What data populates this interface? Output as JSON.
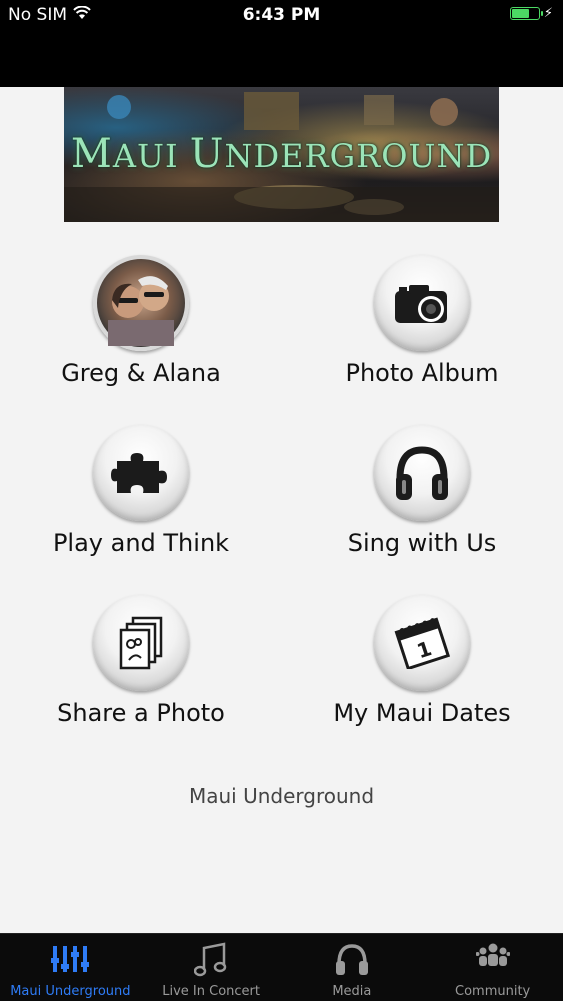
{
  "status_bar": {
    "carrier": "No SIM",
    "time": "6:43 PM",
    "battery_level": 0.7
  },
  "banner": {
    "title_part1": "M",
    "title_part2": "AUI ",
    "title_part3": "U",
    "title_part4": "NDERGROUND"
  },
  "menu": [
    {
      "label": "Greg & Alana",
      "icon": "couple-photo"
    },
    {
      "label": "Photo Album",
      "icon": "camera-icon"
    },
    {
      "label": "Play and Think",
      "icon": "puzzle-icon"
    },
    {
      "label": "Sing with Us",
      "icon": "headphones-icon"
    },
    {
      "label": "Share a Photo",
      "icon": "photos-stack-icon"
    },
    {
      "label": "My Maui Dates",
      "icon": "calendar-icon"
    }
  ],
  "calendar_number": "1",
  "footer": "Maui Underground",
  "tabs": [
    {
      "label": "Maui Underground",
      "icon": "equalizer-icon",
      "active": true
    },
    {
      "label": "Live In Concert",
      "icon": "music-note-icon",
      "active": false
    },
    {
      "label": "Media",
      "icon": "headphones-icon",
      "active": false
    },
    {
      "label": "Community",
      "icon": "people-icon",
      "active": false
    }
  ],
  "colors": {
    "active_tab": "#2f7cf6",
    "battery": "#4cd964",
    "banner_text": "#9be4b8"
  }
}
